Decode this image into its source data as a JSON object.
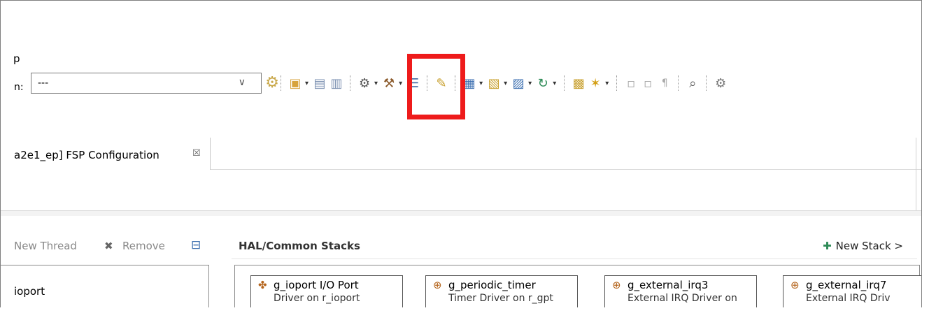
{
  "menu": {
    "fragment": "p"
  },
  "toolbar": {
    "configuration_label": "n:",
    "configuration_value": "---",
    "chevron": "∨",
    "icons": {
      "gear": "⚙",
      "new": "▣",
      "save": "▤",
      "save_all": "▥",
      "debug": "⚙",
      "build": "⚒",
      "binary": "☰",
      "edit": "✎",
      "class": "▦",
      "folder": "▧",
      "file": "▨",
      "refresh": "↻",
      "open": "▩",
      "wand": "✶",
      "doc1": "▫",
      "doc2": "▫",
      "pilcrow": "¶",
      "search": "⌕",
      "settings": "⚙"
    },
    "dropdown": "▾"
  },
  "editor_tab": {
    "title": "a2e1_ep] FSP Configuration",
    "close": "☒"
  },
  "threads_panel": {
    "new_thread": "New Thread",
    "remove": "Remove",
    "remove_icon": "✖",
    "collapse_icon": "⊟",
    "items": [
      "ioport"
    ]
  },
  "stacks_panel": {
    "title": "HAL/Common Stacks",
    "new_stack": "New Stack >",
    "new_stack_icon": "✚",
    "stacks": [
      {
        "name": "g_ioport I/O Port",
        "subtitle": "Driver on r_ioport",
        "icon": "✤"
      },
      {
        "name": "g_periodic_timer",
        "subtitle": "Timer Driver on r_gpt",
        "icon": "⊕"
      },
      {
        "name": "g_external_irq3",
        "subtitle": "External IRQ Driver on",
        "icon": "⊕"
      },
      {
        "name": "g_external_irq7",
        "subtitle": "External IRQ Driv",
        "icon": "⊕"
      }
    ]
  },
  "colors": {
    "highlight": "#ee1b1b"
  }
}
